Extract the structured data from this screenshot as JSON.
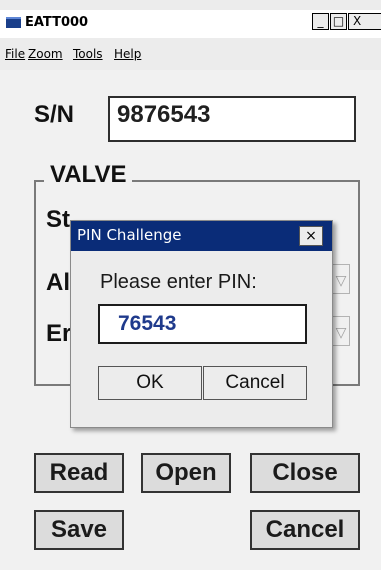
{
  "window": {
    "title": "EATT000",
    "minimize_label": "_",
    "maximize_label": "□",
    "close_label": "X"
  },
  "menu": {
    "items": [
      {
        "label": "File"
      },
      {
        "label": "Zoom"
      },
      {
        "label": "Tools"
      },
      {
        "label": "Help"
      }
    ]
  },
  "serial": {
    "label": "S/N",
    "value": "9876543"
  },
  "valve": {
    "legend": "VALVE",
    "rows": [
      {
        "label": "St"
      },
      {
        "label": "Al"
      },
      {
        "label": "Er"
      }
    ]
  },
  "buttons": {
    "read": "Read",
    "open": "Open",
    "close": "Close",
    "save": "Save",
    "cancel": "Cancel"
  },
  "dialog": {
    "title": "PIN Challenge",
    "close_label": "×",
    "prompt": "Please enter PIN:",
    "pin_value": "76543",
    "ok_label": "OK",
    "cancel_label": "Cancel"
  },
  "colors": {
    "dialog_title_bg": "#0a2c78",
    "pin_text": "#1f3a8c"
  }
}
